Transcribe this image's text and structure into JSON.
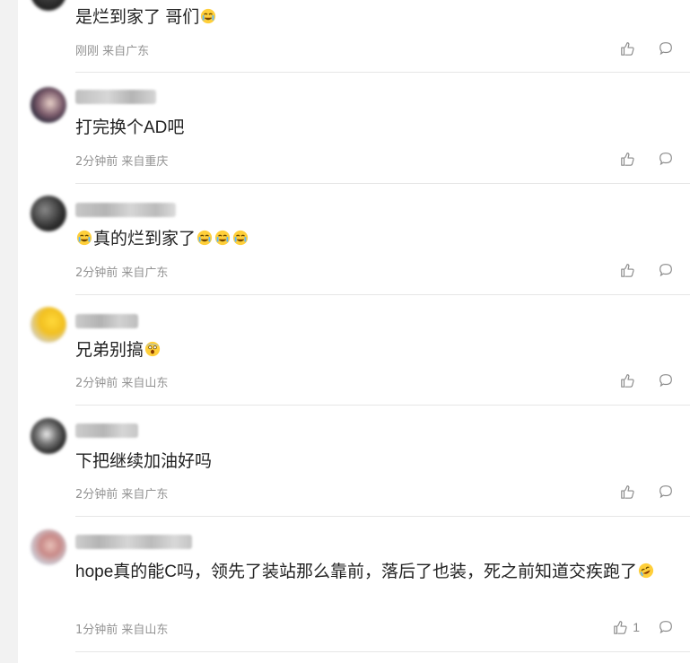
{
  "comments": [
    {
      "content": "是烂到家了 哥们",
      "emoji_after": [
        "crying-laugh"
      ],
      "meta": "刚刚 来自广东",
      "likes": ""
    },
    {
      "content": "打完换个AD吧",
      "emoji_after": [],
      "meta": "2分钟前 来自重庆",
      "likes": ""
    },
    {
      "content_pre_emoji": [
        "crying-laugh"
      ],
      "content": "真的烂到家了",
      "emoji_after": [
        "crying-laugh",
        "crying-laugh",
        "crying-laugh"
      ],
      "meta": "2分钟前 来自广东",
      "likes": ""
    },
    {
      "content": "兄弟别搞",
      "emoji_after": [
        "scared"
      ],
      "meta": "2分钟前 来自山东",
      "likes": ""
    },
    {
      "content": "下把继续加油好吗",
      "emoji_after": [],
      "meta": "2分钟前 来自广东",
      "likes": ""
    },
    {
      "content": "hope真的能C吗，领先了装站那么靠前，落后了也装，死之前知道交疾跑了",
      "emoji_after": [
        "rolling-laugh"
      ],
      "meta": "1分钟前 来自山东",
      "likes": "1"
    }
  ],
  "icons": {
    "like": "thumbs-up-icon",
    "reply": "comment-bubble-icon"
  },
  "colors": {
    "text": "#222222",
    "meta": "#939393",
    "divider": "#e6e6e6",
    "gutter": "#f2f2f2"
  }
}
